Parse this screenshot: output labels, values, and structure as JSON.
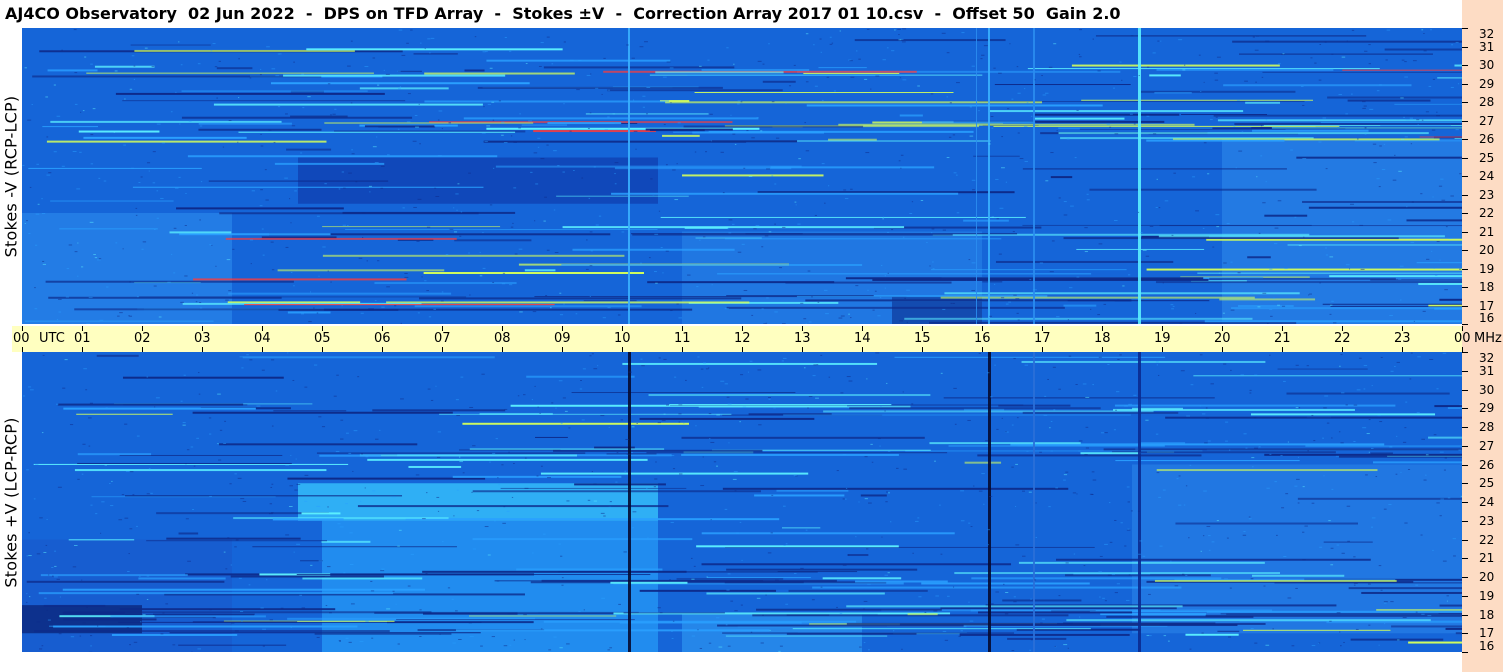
{
  "title": "AJ4CO Observatory  02 Jun 2022  -  DPS on TFD Array  -  Stokes ±V  -  Correction Array 2017 01 10.csv  -  Offset 50  Gain 2.0",
  "chart_data": [
    {
      "type": "heatmap",
      "ylabel": "Stokes -V (RCP-LCP)",
      "xlabel": "UTC",
      "x_ticks": [
        "00",
        "01",
        "02",
        "03",
        "04",
        "05",
        "06",
        "07",
        "08",
        "09",
        "10",
        "11",
        "12",
        "13",
        "14",
        "15",
        "16",
        "17",
        "18",
        "19",
        "20",
        "21",
        "22",
        "23",
        "00"
      ],
      "x_unit": "UTC",
      "xlim": [
        0,
        24
      ],
      "y_unit": "MHz",
      "ylim": [
        16,
        32
      ],
      "y_ticks": [
        "16",
        "17",
        "18",
        "19",
        "20",
        "21",
        "22",
        "23",
        "24",
        "25",
        "26",
        "27",
        "28",
        "29",
        "30",
        "31",
        "32"
      ],
      "colormap": [
        "#0d2a8a",
        "#1565d8",
        "#2aa0ff",
        "#5cf0ff",
        "#d4ff5a",
        "#ff3b3b"
      ],
      "background_color": "#1565d8"
    },
    {
      "type": "heatmap",
      "ylabel": "Stokes +V (LCP-RCP)",
      "xlabel": "UTC",
      "x_ticks": [
        "00",
        "01",
        "02",
        "03",
        "04",
        "05",
        "06",
        "07",
        "08",
        "09",
        "10",
        "11",
        "12",
        "13",
        "14",
        "15",
        "16",
        "17",
        "18",
        "19",
        "20",
        "21",
        "22",
        "23",
        "00"
      ],
      "x_unit": "UTC",
      "xlim": [
        0,
        24
      ],
      "y_unit": "MHz",
      "ylim": [
        16,
        32
      ],
      "y_ticks": [
        "16",
        "17",
        "18",
        "19",
        "20",
        "21",
        "22",
        "23",
        "24",
        "25",
        "26",
        "27",
        "28",
        "29",
        "30",
        "31",
        "32"
      ],
      "colormap": [
        "#0d2a8a",
        "#1565d8",
        "#2aa0ff",
        "#5cf0ff",
        "#d4ff5a",
        "#ff3b3b"
      ],
      "background_color": "#1565d8"
    }
  ],
  "axis": {
    "utc_label": "UTC",
    "mhz_label": "MHz"
  },
  "colors": {
    "axis_band": "#ffffc0",
    "right_strip": "#fddcc4"
  }
}
